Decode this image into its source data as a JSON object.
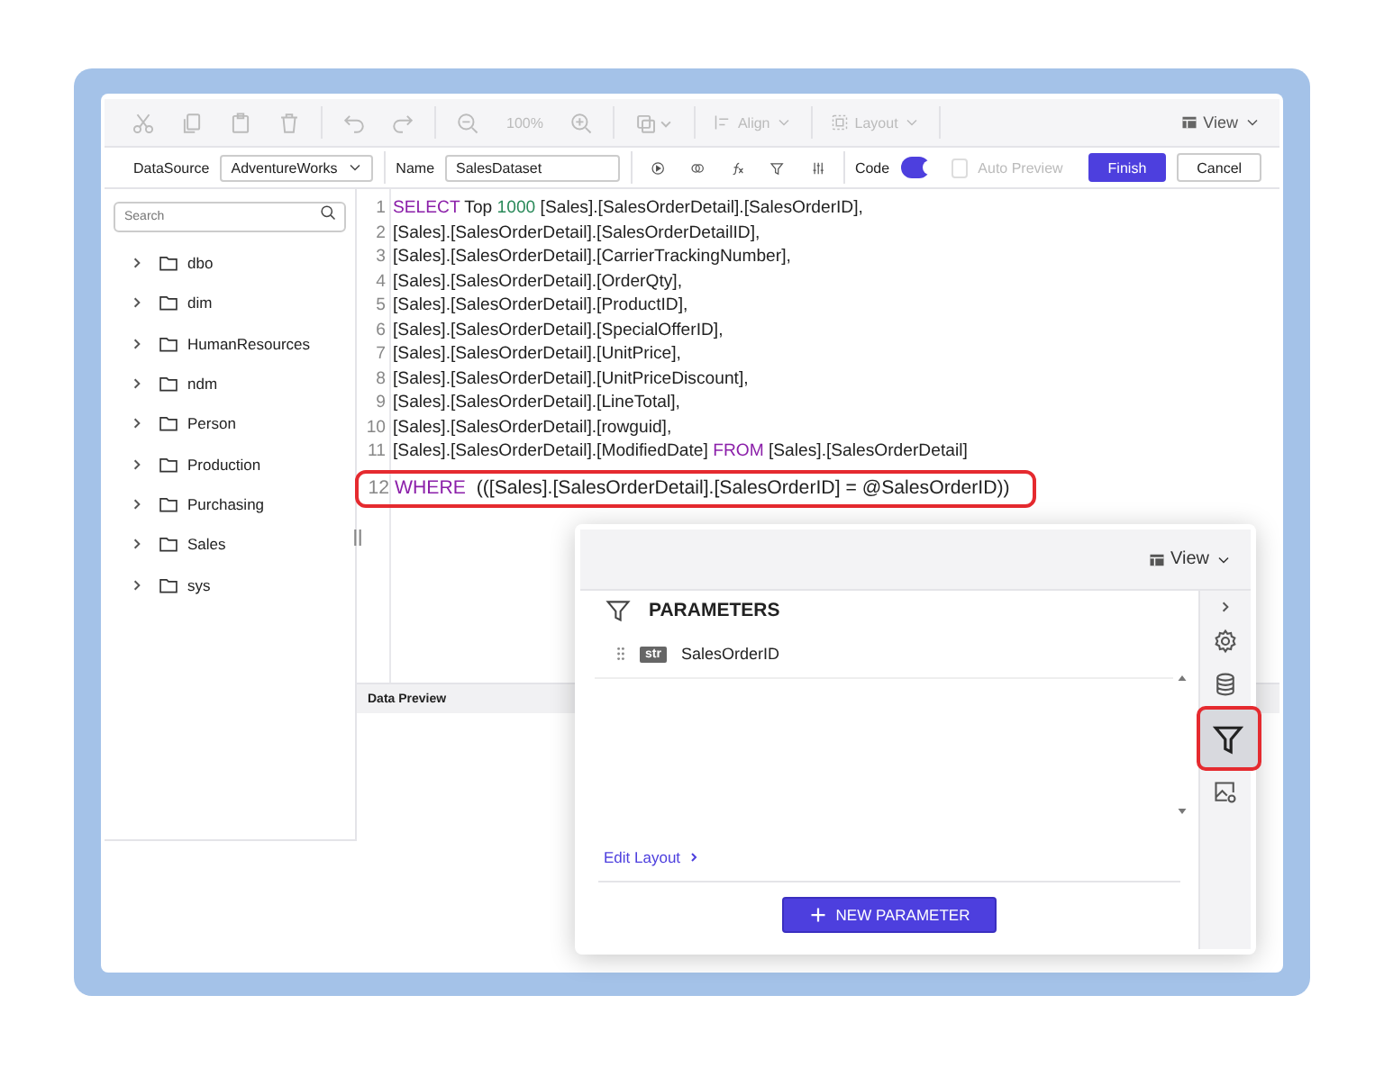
{
  "toolbar": {
    "disabled": true,
    "zoom": "100%",
    "align_label": "Align",
    "layout_label": "Layout",
    "view_label": "View"
  },
  "dataset_bar": {
    "datasource_label": "DataSource",
    "datasource": "AdventureWorks",
    "name_label": "Name",
    "name": "SalesDataset",
    "code_label": "Code",
    "code_on": true,
    "auto_preview": {
      "label": "Auto Preview",
      "checked": false,
      "disabled": true
    },
    "buttons": [
      {
        "label": "Finish",
        "kind": "primary"
      },
      {
        "label": "Cancel",
        "kind": "secondary"
      }
    ]
  },
  "tree": {
    "search": {
      "placeholder": "Search"
    },
    "items": [
      {
        "label": "dbo",
        "expanded": false
      },
      {
        "label": "dim",
        "expanded": false
      },
      {
        "label": "HumanResources",
        "expanded": false
      },
      {
        "label": "ndm",
        "expanded": false
      },
      {
        "label": "Person",
        "expanded": false
      },
      {
        "label": "Production",
        "expanded": false
      },
      {
        "label": "Purchasing",
        "expanded": false
      },
      {
        "label": "Sales",
        "expanded": false
      },
      {
        "label": "sys",
        "expanded": false
      }
    ]
  },
  "editor": {
    "lines": [
      {
        "number": "1",
        "highlighted": false,
        "tokens": [
          {
            "kind": "keyword",
            "text": "SELECT"
          },
          {
            "kind": "text",
            "text": " Top "
          },
          {
            "kind": "number",
            "text": "1000"
          },
          {
            "kind": "text",
            "text": " [Sales].[SalesOrderDetail].[SalesOrderID],"
          }
        ]
      },
      {
        "number": "2",
        "highlighted": false,
        "tokens": [
          {
            "kind": "text",
            "text": "[Sales].[SalesOrderDetail].[SalesOrderDetailID],"
          }
        ]
      },
      {
        "number": "3",
        "highlighted": false,
        "tokens": [
          {
            "kind": "text",
            "text": "[Sales].[SalesOrderDetail].[CarrierTrackingNumber],"
          }
        ]
      },
      {
        "number": "4",
        "highlighted": false,
        "tokens": [
          {
            "kind": "text",
            "text": "[Sales].[SalesOrderDetail].[OrderQty],"
          }
        ]
      },
      {
        "number": "5",
        "highlighted": false,
        "tokens": [
          {
            "kind": "text",
            "text": "[Sales].[SalesOrderDetail].[ProductID],"
          }
        ]
      },
      {
        "number": "6",
        "highlighted": false,
        "tokens": [
          {
            "kind": "text",
            "text": "[Sales].[SalesOrderDetail].[SpecialOfferID],"
          }
        ]
      },
      {
        "number": "7",
        "highlighted": false,
        "tokens": [
          {
            "kind": "text",
            "text": "[Sales].[SalesOrderDetail].[UnitPrice],"
          }
        ]
      },
      {
        "number": "8",
        "highlighted": false,
        "tokens": [
          {
            "kind": "text",
            "text": "[Sales].[SalesOrderDetail].[UnitPriceDiscount],"
          }
        ]
      },
      {
        "number": "9",
        "highlighted": false,
        "tokens": [
          {
            "kind": "text",
            "text": "[Sales].[SalesOrderDetail].[LineTotal],"
          }
        ]
      },
      {
        "number": "10",
        "highlighted": false,
        "tokens": [
          {
            "kind": "text",
            "text": "[Sales].[SalesOrderDetail].[rowguid],"
          }
        ]
      },
      {
        "number": "11",
        "highlighted": false,
        "tokens": [
          {
            "kind": "text",
            "text": "[Sales].[SalesOrderDetail].[ModifiedDate] "
          },
          {
            "kind": "keyword",
            "text": "FROM"
          },
          {
            "kind": "text",
            "text": " [Sales].[SalesOrderDetail]"
          }
        ]
      },
      {
        "number": "12",
        "highlighted": true,
        "tokens": [
          {
            "kind": "keyword",
            "text": "WHERE"
          },
          {
            "kind": "text",
            "text": "  (([Sales].[SalesOrderDetail].[SalesOrderID] = @SalesOrderID))"
          }
        ]
      }
    ]
  },
  "data_preview": {
    "title": "Data Preview"
  },
  "parameters_panel": {
    "view_label": "View",
    "title": "PARAMETERS",
    "items": [
      {
        "type": "str",
        "name": "SalesOrderID"
      }
    ],
    "edit_layout": "Edit Layout",
    "new_button": "NEW PARAMETER",
    "rail": [
      {
        "kind": "settings",
        "selected": false
      },
      {
        "kind": "database",
        "selected": false
      },
      {
        "kind": "filter",
        "selected": true
      },
      {
        "kind": "image",
        "selected": false
      }
    ]
  }
}
